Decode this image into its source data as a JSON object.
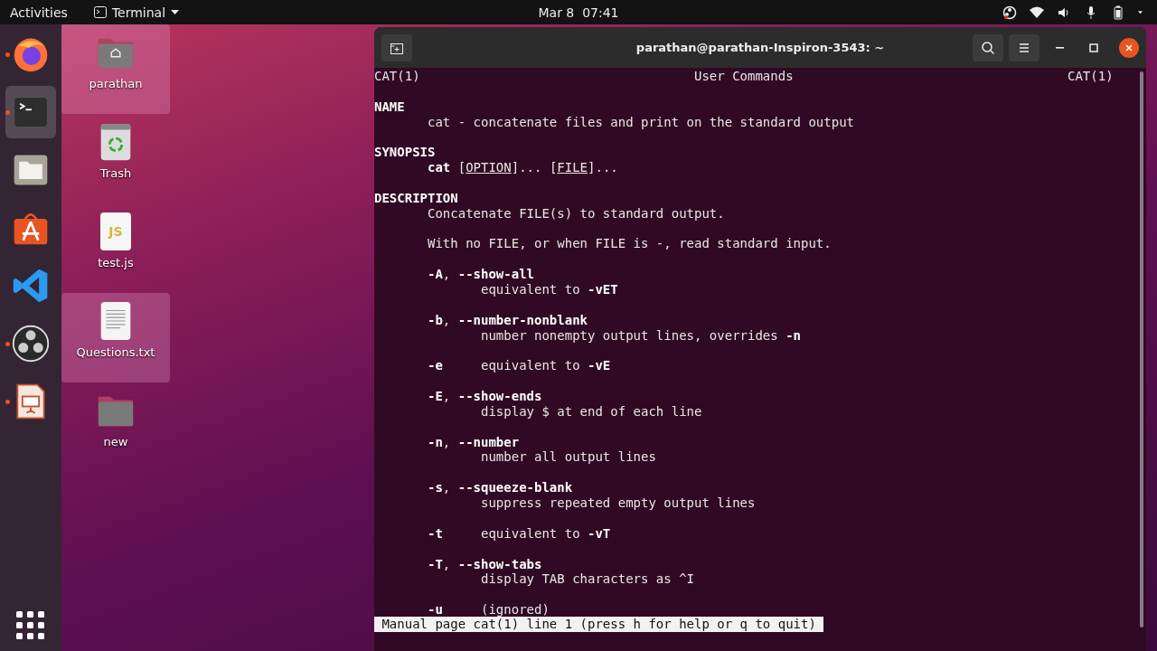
{
  "top_bar": {
    "activities": "Activities",
    "app_menu": "Terminal",
    "clock": "Mar 8  07:41"
  },
  "dock": {
    "items": [
      {
        "kind": "firefox",
        "running": true,
        "active": false
      },
      {
        "kind": "terminal",
        "running": true,
        "active": true
      },
      {
        "kind": "files",
        "running": false,
        "active": false
      },
      {
        "kind": "software",
        "running": false,
        "active": false
      },
      {
        "kind": "vscode",
        "running": false,
        "active": false
      },
      {
        "kind": "obs",
        "running": true,
        "active": false
      },
      {
        "kind": "impress",
        "running": true,
        "active": false
      }
    ]
  },
  "desktop_icons": [
    {
      "kind": "home-folder",
      "label": "parathan",
      "selected": true
    },
    {
      "kind": "trash",
      "label": "Trash",
      "selected": false
    },
    {
      "kind": "js-file",
      "label": "test.js",
      "badge": "JS",
      "selected": false
    },
    {
      "kind": "text-file",
      "label": "Questions.txt",
      "selected": true
    },
    {
      "kind": "folder",
      "label": "new",
      "selected": false
    }
  ],
  "terminal": {
    "title": "parathan@parathan-Inspiron-3543: ~",
    "header": {
      "left": "CAT(1)",
      "center": "User Commands",
      "right": "CAT(1)"
    },
    "paragraphs": [
      {
        "lines": [
          {
            "kind": "heading",
            "text": "NAME"
          },
          {
            "kind": "body",
            "text": "cat - concatenate files and print on the standard output"
          }
        ]
      },
      {
        "lines": [
          {
            "kind": "heading",
            "text": "SYNOPSIS"
          },
          {
            "kind": "body",
            "text": "**cat** [*OPTION*]... [*FILE*]..."
          }
        ]
      },
      {
        "lines": [
          {
            "kind": "heading",
            "text": "DESCRIPTION"
          },
          {
            "kind": "body",
            "text": "Concatenate FILE(s) to standard output."
          }
        ]
      },
      {
        "lines": [
          {
            "kind": "body",
            "text": "With no FILE, or when FILE is -, read standard input."
          }
        ]
      },
      {
        "lines": [
          {
            "kind": "body",
            "text": "**-A**, **--show-all**"
          },
          {
            "kind": "detail",
            "text": "equivalent to **-vET**"
          }
        ]
      },
      {
        "lines": [
          {
            "kind": "body",
            "text": "**-b**, **--number-nonblank**"
          },
          {
            "kind": "detail",
            "text": "number nonempty output lines, overrides **-n**"
          }
        ]
      },
      {
        "lines": [
          {
            "kind": "body",
            "text": "**-e**     equivalent to **-vE**"
          }
        ]
      },
      {
        "lines": [
          {
            "kind": "body",
            "text": "**-E**, **--show-ends**"
          },
          {
            "kind": "detail",
            "text": "display $ at end of each line"
          }
        ]
      },
      {
        "lines": [
          {
            "kind": "body",
            "text": "**-n**, **--number**"
          },
          {
            "kind": "detail",
            "text": "number all output lines"
          }
        ]
      },
      {
        "lines": [
          {
            "kind": "body",
            "text": "**-s**, **--squeeze-blank**"
          },
          {
            "kind": "detail",
            "text": "suppress repeated empty output lines"
          }
        ]
      },
      {
        "lines": [
          {
            "kind": "body",
            "text": "**-t**     equivalent to **-vT**"
          }
        ]
      },
      {
        "lines": [
          {
            "kind": "body",
            "text": "**-T**, **--show-tabs**"
          },
          {
            "kind": "detail",
            "text": "display TAB characters as ^I"
          }
        ]
      },
      {
        "lines": [
          {
            "kind": "body",
            "text": "**-u**     (ignored)"
          }
        ]
      }
    ],
    "status": "Manual page cat(1) line 1 (press h for help or q to quit)"
  }
}
